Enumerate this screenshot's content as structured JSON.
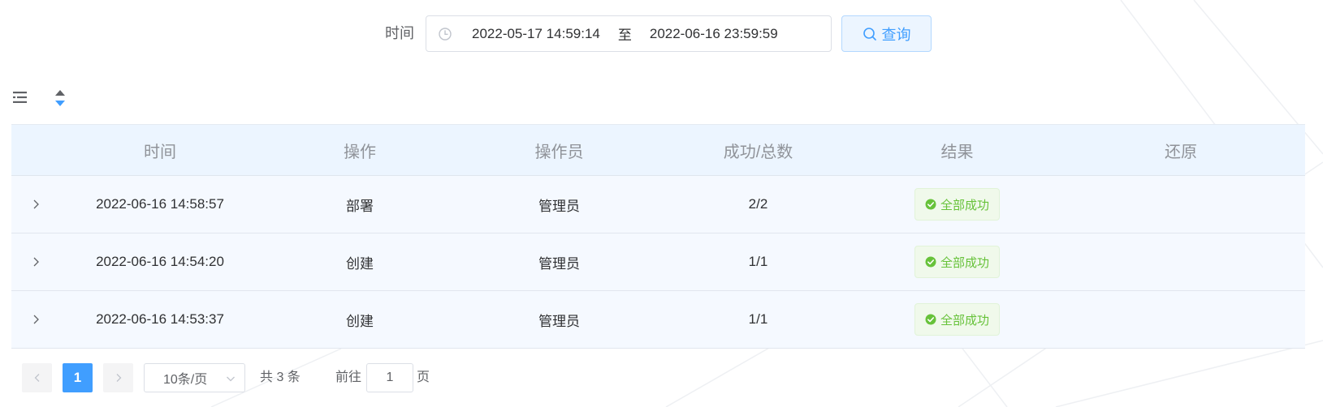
{
  "filter": {
    "label": "时间",
    "date_start": "2022-05-17 14:59:14",
    "date_separator": "至",
    "date_end": "2022-06-16 23:59:59",
    "query_label": "查询"
  },
  "table": {
    "headers": [
      "时间",
      "操作",
      "操作员",
      "成功/总数",
      "结果",
      "还原"
    ],
    "rows": [
      {
        "time": "2022-06-16 14:58:57",
        "operation": "部署",
        "operator": "管理员",
        "ratio": "2/2",
        "result": "全部成功",
        "restore": ""
      },
      {
        "time": "2022-06-16 14:54:20",
        "operation": "创建",
        "operator": "管理员",
        "ratio": "1/1",
        "result": "全部成功",
        "restore": ""
      },
      {
        "time": "2022-06-16 14:53:37",
        "operation": "创建",
        "operator": "管理员",
        "ratio": "1/1",
        "result": "全部成功",
        "restore": ""
      }
    ]
  },
  "pagination": {
    "current_page": "1",
    "page_size": "10条/页",
    "total": "共 3 条",
    "goto_label": "前往",
    "goto_value": "1",
    "page_label": "页"
  },
  "colors": {
    "primary": "#409eff",
    "success": "#67c23a",
    "header_bg": "#ecf5ff",
    "row_bg": "#f5f9ff"
  },
  "icons": {
    "clock": "clock-icon",
    "search": "search-icon",
    "list": "list-settings-icon",
    "sort": "sort-icon",
    "expand": "chevron-right-icon",
    "success": "check-circle-icon",
    "prev": "chevron-left-icon",
    "next": "chevron-right-icon",
    "dropdown": "chevron-down-icon"
  }
}
